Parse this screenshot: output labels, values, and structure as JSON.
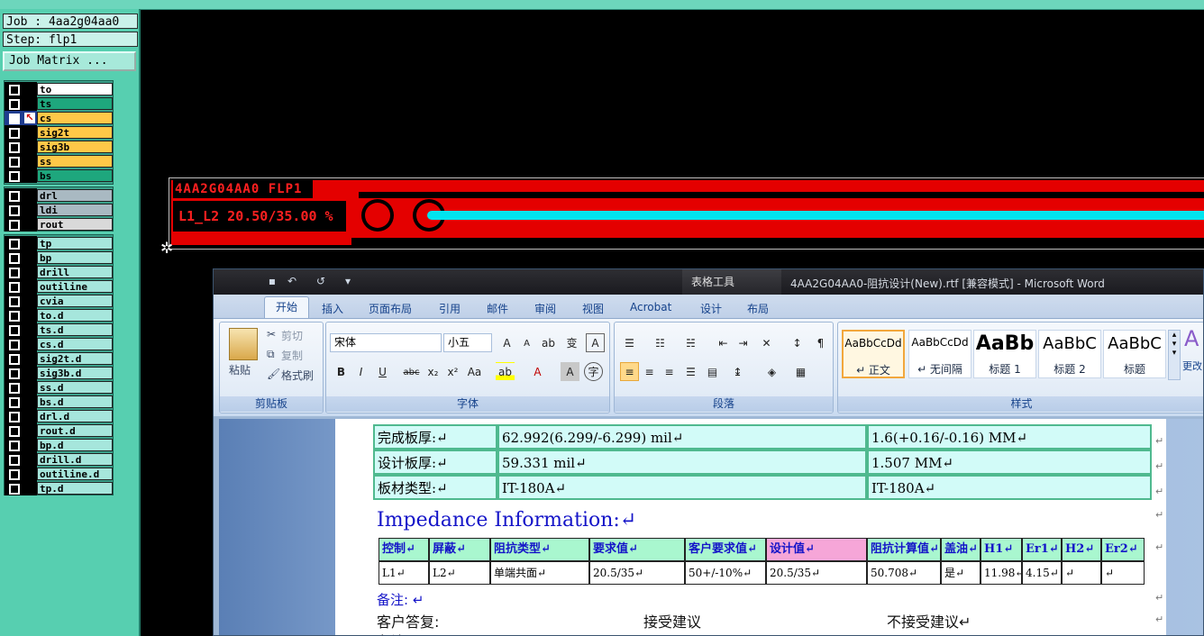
{
  "job": {
    "job_label": "Job : 4aa2g04aa0",
    "step_label": "Step: flp1",
    "matrix_button": "Job Matrix ..."
  },
  "layers_board": [
    {
      "name": "to",
      "color": "#ffffff"
    },
    {
      "name": "ts",
      "color": "#1ea77d"
    },
    {
      "name": "cs",
      "color": "#ffc848"
    },
    {
      "name": "sig2t",
      "color": "#ffc848"
    },
    {
      "name": "sig3b",
      "color": "#ffc848"
    },
    {
      "name": "ss",
      "color": "#ffc848"
    },
    {
      "name": "bs",
      "color": "#1ea77d"
    }
  ],
  "layers_drill": [
    {
      "name": "drl",
      "color": "#a9b9c2"
    },
    {
      "name": "ldi",
      "color": "#a9b9c2"
    },
    {
      "name": "rout",
      "color": "#d9d9d9"
    }
  ],
  "layers_misc": [
    "tp",
    "bp",
    "drill",
    "outiline",
    "cvia",
    "to.d",
    "ts.d",
    "cs.d",
    "sig2t.d",
    "sig3b.d",
    "ss.d",
    "bs.d",
    "drl.d",
    "rout.d",
    "bp.d",
    "drill.d",
    "outiline.d",
    "tp.d"
  ],
  "canvas": {
    "label1": "4AA2G04AA0 FLP1",
    "label2": "L1_L2 20.50/35.00 %"
  },
  "word": {
    "title": "4AA2G04AA0-阻抗设计(New).rtf [兼容模式] - Microsoft Word",
    "tool_tab": "表格工具",
    "tabs": [
      "开始",
      "插入",
      "页面布局",
      "引用",
      "邮件",
      "审阅",
      "视图",
      "Acrobat",
      "设计",
      "布局"
    ],
    "clipboard": {
      "paste": "粘贴",
      "cut": "剪切",
      "copy": "复制",
      "format_painter": "格式刷",
      "label": "剪贴板"
    },
    "font": {
      "name": "宋体",
      "size": "小五",
      "label": "字体"
    },
    "paragraph": {
      "label": "段落"
    },
    "styles": {
      "items": [
        {
          "sample": "AaBbCcDd",
          "name": "↵ 正文"
        },
        {
          "sample": "AaBbCcDd",
          "name": "↵ 无间隔"
        },
        {
          "sample": "AaBb",
          "name": "标题 1"
        },
        {
          "sample": "AaBbC",
          "name": "标题 2"
        },
        {
          "sample": "AaBbC",
          "name": "标题"
        }
      ],
      "change": "更改",
      "label": "样式"
    }
  },
  "document": {
    "spec_rows": [
      [
        "完成板厚:↵",
        "62.992(6.299/-6.299) mil↵",
        "1.6(+0.16/-0.16) MM↵"
      ],
      [
        "设计板厚:↵",
        "59.331 mil↵",
        "1.507 MM↵"
      ],
      [
        "板材类型:↵",
        "IT-180A↵",
        "IT-180A↵"
      ]
    ],
    "heading": "Impedance Information:↵",
    "imp_headers": [
      "控制↵",
      "屏蔽↵",
      "阻抗类型↵",
      "要求值↵",
      "客户要求值↵",
      "设计值↵",
      "阻抗计算值↵",
      "盖油↵",
      "H1↵",
      "Er1↵",
      "H2↵",
      "Er2↵"
    ],
    "imp_row": [
      "L1↵",
      "L2↵",
      "单端共面↵",
      "20.5/35↵",
      "50+/-10%↵",
      "20.5/35↵",
      "50.708↵",
      "是↵",
      "11.98↵",
      "4.15↵",
      "↵",
      "↵"
    ],
    "note": "备注: ↵",
    "reply_label": "客户答复:",
    "accept": "接受建议",
    "reject": "不接受建议↵",
    "note2": "备注"
  }
}
